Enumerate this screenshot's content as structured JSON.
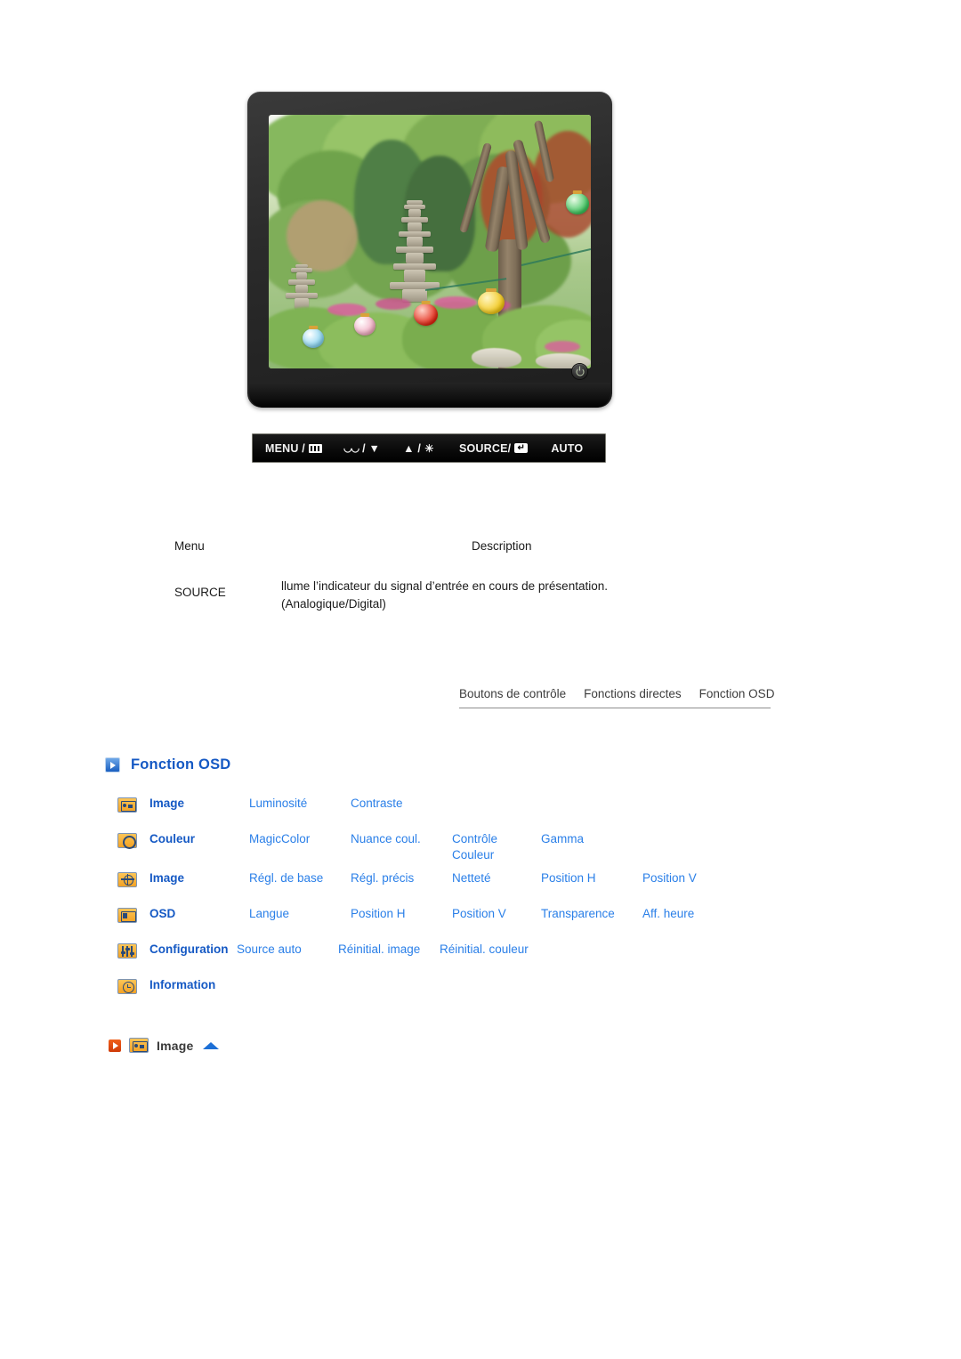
{
  "monitor": {
    "alt": "Samsung LCD monitor displaying a Korean temple garden with a stone pagoda and paper lanterns",
    "power_button": "power-button"
  },
  "control_bar": {
    "items": [
      {
        "label": "MENU /",
        "icon": "menu-grid-icon"
      },
      {
        "label": "/ ▼",
        "icon": "magicbright-icon"
      },
      {
        "label": "▲ /",
        "icon": "brightness-sun-icon"
      },
      {
        "label": "SOURCE/",
        "icon": "enter-icon"
      },
      {
        "label": "AUTO",
        "icon": ""
      }
    ]
  },
  "desc_table": {
    "headers": {
      "menu": "Menu",
      "description": "Description"
    },
    "rows": [
      {
        "menu": "SOURCE",
        "description_line1": "llume l’indicateur du signal d’entrée en cours de présentation.",
        "description_line2": "(Analogique/Digital)"
      }
    ]
  },
  "tabs": [
    {
      "label": "Boutons de contrôle"
    },
    {
      "label": "Fonctions directes"
    },
    {
      "label": "Fonction OSD"
    }
  ],
  "osd_heading": {
    "title": "Fonction OSD",
    "icon": "blue-arrow-icon"
  },
  "osd_matrix": {
    "rows": [
      {
        "icon": "picture-icon",
        "label": "Image",
        "cells": [
          "Luminosité",
          "Contraste"
        ]
      },
      {
        "icon": "color-icon",
        "label": "Couleur",
        "cells": [
          "MagicColor",
          "Nuance coul.",
          "Contrôle Couleur",
          "Gamma"
        ]
      },
      {
        "icon": "geometry-icon",
        "label": "Image",
        "cells": [
          "Régl. de base",
          "Régl. précis",
          "Netteté",
          "Position H",
          "Position V"
        ]
      },
      {
        "icon": "osd-panel-icon",
        "label": "OSD",
        "cells": [
          "Langue",
          "Position H",
          "Position V",
          "Transparence",
          "Aff. heure"
        ]
      },
      {
        "icon": "configuration-icon",
        "label": "Configuration",
        "cells": [
          "Source auto",
          "Réinitial. image",
          "Réinitial. couleur"
        ]
      },
      {
        "icon": "information-icon",
        "label": "Information",
        "cells": []
      }
    ]
  },
  "image_section": {
    "title": "Image",
    "red_icon": "red-play-icon",
    "menu_icon": "picture-icon",
    "tri_icon": "blue-triangle-icon"
  },
  "colors": {
    "link_blue": "#2a7fe8",
    "label_blue": "#1559c4",
    "icon_orange": "#f3a224",
    "icon_border": "#7d95b5",
    "red_accent": "#cf3a08"
  }
}
